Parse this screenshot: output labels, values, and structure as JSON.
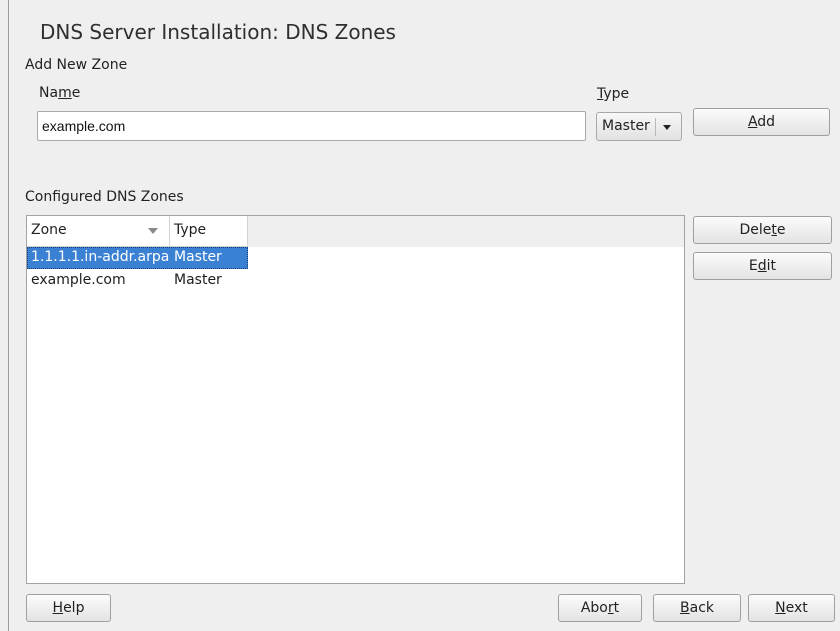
{
  "window": {
    "title": "DNS Server Installation: DNS Zones"
  },
  "add_zone": {
    "section_label": "Add New Zone",
    "name_label": "Name",
    "name_value": "example.com",
    "type_label": "Type",
    "type_selected": "Master",
    "add_button": "Add"
  },
  "configured": {
    "section_label": "Configured DNS Zones",
    "columns": [
      "Zone",
      "Type"
    ],
    "rows": [
      {
        "zone": "1.1.1.1.in-addr.arpa",
        "type": "Master",
        "selected": true
      },
      {
        "zone": "example.com",
        "type": "Master",
        "selected": false
      }
    ],
    "delete_button": "Delete",
    "edit_button": "Edit"
  },
  "footer": {
    "help_button": "Help",
    "abort_button": "Abort",
    "back_button": "Back",
    "next_button": "Next"
  },
  "icons": {
    "combo": "chevron-down-icon",
    "sort": "sort-descending-icon"
  },
  "colors": {
    "selection": "#3b81d3",
    "background": "#efefef"
  }
}
